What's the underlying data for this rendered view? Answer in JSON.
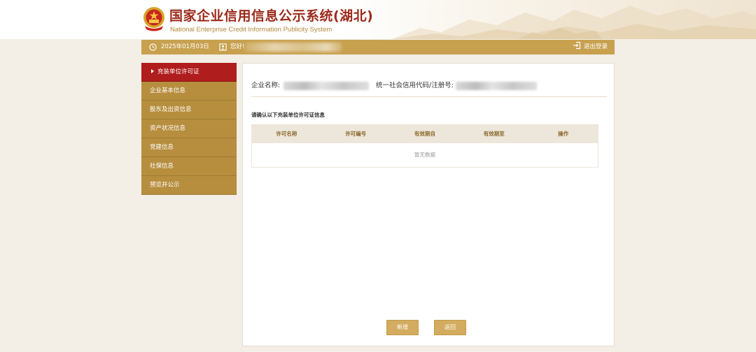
{
  "header": {
    "title": "国家企业信用信息公示系统(湖北)",
    "subtitle": "National Enterprise Credit Information Publicity System"
  },
  "topbar": {
    "date": "2025年01月03日",
    "greeting": "您好!",
    "logout_label": "退出登录"
  },
  "sidebar": {
    "items": [
      {
        "label": "充装单位许可证",
        "active": true
      },
      {
        "label": "企业基本信息",
        "active": false
      },
      {
        "label": "股东及出资信息",
        "active": false
      },
      {
        "label": "资产状况信息",
        "active": false
      },
      {
        "label": "党建信息",
        "active": false
      },
      {
        "label": "社保信息",
        "active": false
      },
      {
        "label": "预览并公示",
        "active": false
      }
    ]
  },
  "main": {
    "company_name_label": "企业名称:",
    "credit_code_label": "统一社会信用代码/注册号:",
    "section_title": "请确认以下充装单位许可证信息",
    "table": {
      "columns": [
        "许可名称",
        "许可编号",
        "有效期自",
        "有效期至",
        "操作"
      ],
      "empty_text": "暂无数据"
    },
    "buttons": {
      "add_label": "新增",
      "back_label": "返回"
    }
  },
  "colors": {
    "brand_gold": "#c8a14f",
    "sidebar_gold": "#b68e3e",
    "active_red": "#b01d1d",
    "title_red": "#9b2a1a",
    "button_gold": "#d4ac60"
  }
}
